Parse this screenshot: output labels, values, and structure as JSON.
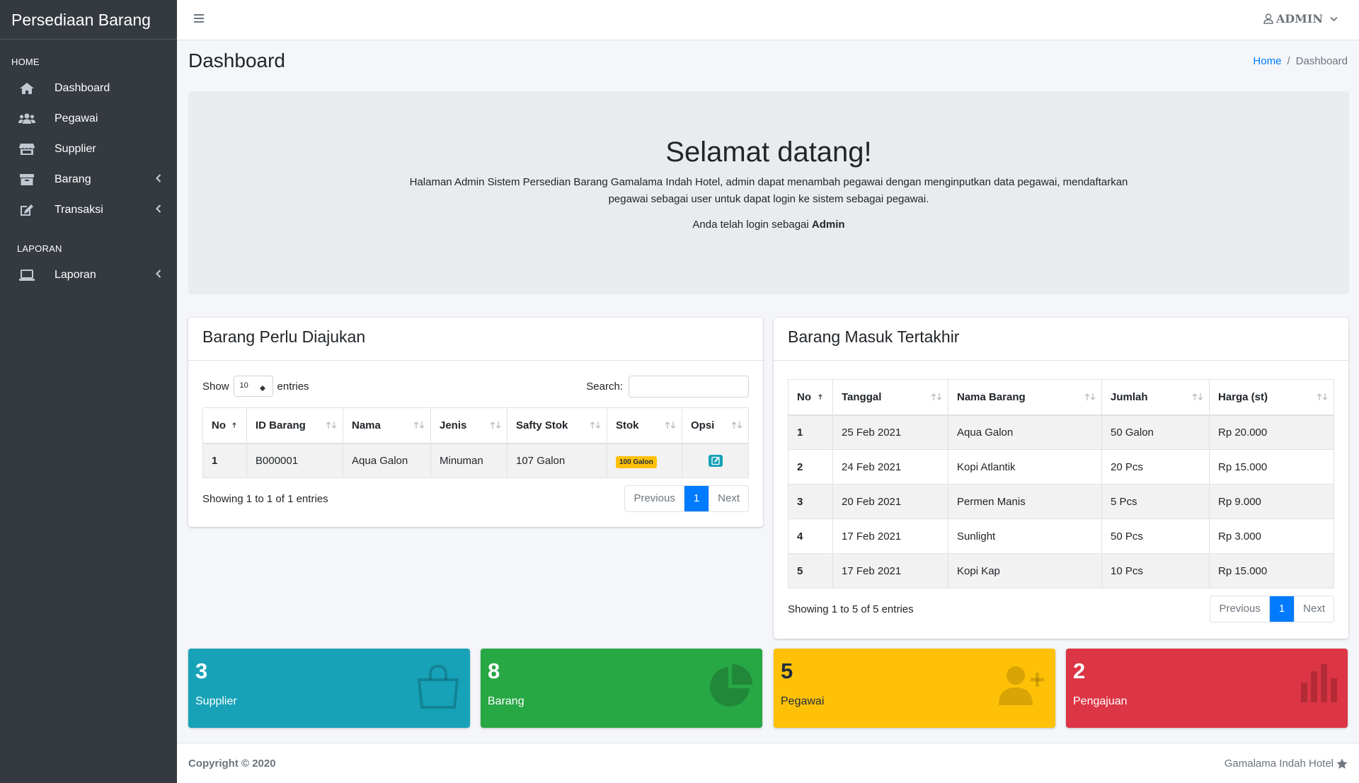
{
  "sidebar": {
    "brand": "Persediaan Barang",
    "header_home": "HOME",
    "header_laporan": "LAPORAN",
    "items": [
      {
        "label": "Dashboard",
        "icon": "home-icon"
      },
      {
        "label": "Pegawai",
        "icon": "users-icon"
      },
      {
        "label": "Supplier",
        "icon": "store-icon"
      },
      {
        "label": "Barang",
        "icon": "archive-icon"
      },
      {
        "label": "Transaksi",
        "icon": "edit-icon"
      },
      {
        "label": "Laporan",
        "icon": "laptop-icon"
      }
    ]
  },
  "topbar": {
    "user": "ADMIN"
  },
  "page": {
    "title": "Dashboard",
    "breadcrumb_home": "Home",
    "breadcrumb_sep": "/",
    "breadcrumb_current": "Dashboard"
  },
  "jumbotron": {
    "heading": "Selamat datang!",
    "description": "Halaman Admin Sistem Persedian Barang Gamalama Indah Hotel, admin dapat menambah pegawai dengan menginputkan data pegawai, mendaftarkan pegawai sebagai user untuk dapat login ke sistem sebagai pegawai.",
    "login_prefix": "Anda telah login sebagai ",
    "login_user": "Admin"
  },
  "table_perlu": {
    "title": "Barang Perlu Diajukan",
    "show_label": "Show",
    "entries_value": "10",
    "entries_label": "entries",
    "search_label": "Search:",
    "columns": [
      "No",
      "ID Barang",
      "Nama",
      "Jenis",
      "Safty Stok",
      "Stok",
      "Opsi"
    ],
    "rows": [
      {
        "no": "1",
        "id": "B000001",
        "nama": "Aqua Galon",
        "jenis": "Minuman",
        "safty": "107 Galon",
        "stok": "100 Galon"
      }
    ],
    "info": "Showing 1 to 1 of 1 entries",
    "prev": "Previous",
    "page": "1",
    "next": "Next"
  },
  "table_masuk": {
    "title": "Barang Masuk Tertakhir",
    "columns": [
      "No",
      "Tanggal",
      "Nama Barang",
      "Jumlah",
      "Harga (st)"
    ],
    "rows": [
      {
        "no": "1",
        "tanggal": "25 Feb 2021",
        "nama": "Aqua Galon",
        "jumlah": "50 Galon",
        "harga": "Rp 20.000"
      },
      {
        "no": "2",
        "tanggal": "24 Feb 2021",
        "nama": "Kopi Atlantik",
        "jumlah": "20 Pcs",
        "harga": "Rp 15.000"
      },
      {
        "no": "3",
        "tanggal": "20 Feb 2021",
        "nama": "Permen Manis",
        "jumlah": "5 Pcs",
        "harga": "Rp 9.000"
      },
      {
        "no": "4",
        "tanggal": "17 Feb 2021",
        "nama": "Sunlight",
        "jumlah": "50 Pcs",
        "harga": "Rp 3.000"
      },
      {
        "no": "5",
        "tanggal": "17 Feb 2021",
        "nama": "Kopi Kap",
        "jumlah": "10 Pcs",
        "harga": "Rp 15.000"
      }
    ],
    "info": "Showing 1 to 5 of 5 entries",
    "prev": "Previous",
    "page": "1",
    "next": "Next"
  },
  "stats": [
    {
      "value": "3",
      "label": "Supplier",
      "color": "#17a2b8",
      "icon": "shopping-bag-icon"
    },
    {
      "value": "8",
      "label": "Barang",
      "color": "#28a745",
      "icon": "pie-chart-icon"
    },
    {
      "value": "5",
      "label": "Pegawai",
      "color": "#ffc107",
      "icon": "user-plus-icon"
    },
    {
      "value": "2",
      "label": "Pengajuan",
      "color": "#dc3545",
      "icon": "bar-chart-icon"
    }
  ],
  "footer": {
    "copyright": "Copyright © 2020",
    "company": "Gamalama Indah Hotel"
  }
}
